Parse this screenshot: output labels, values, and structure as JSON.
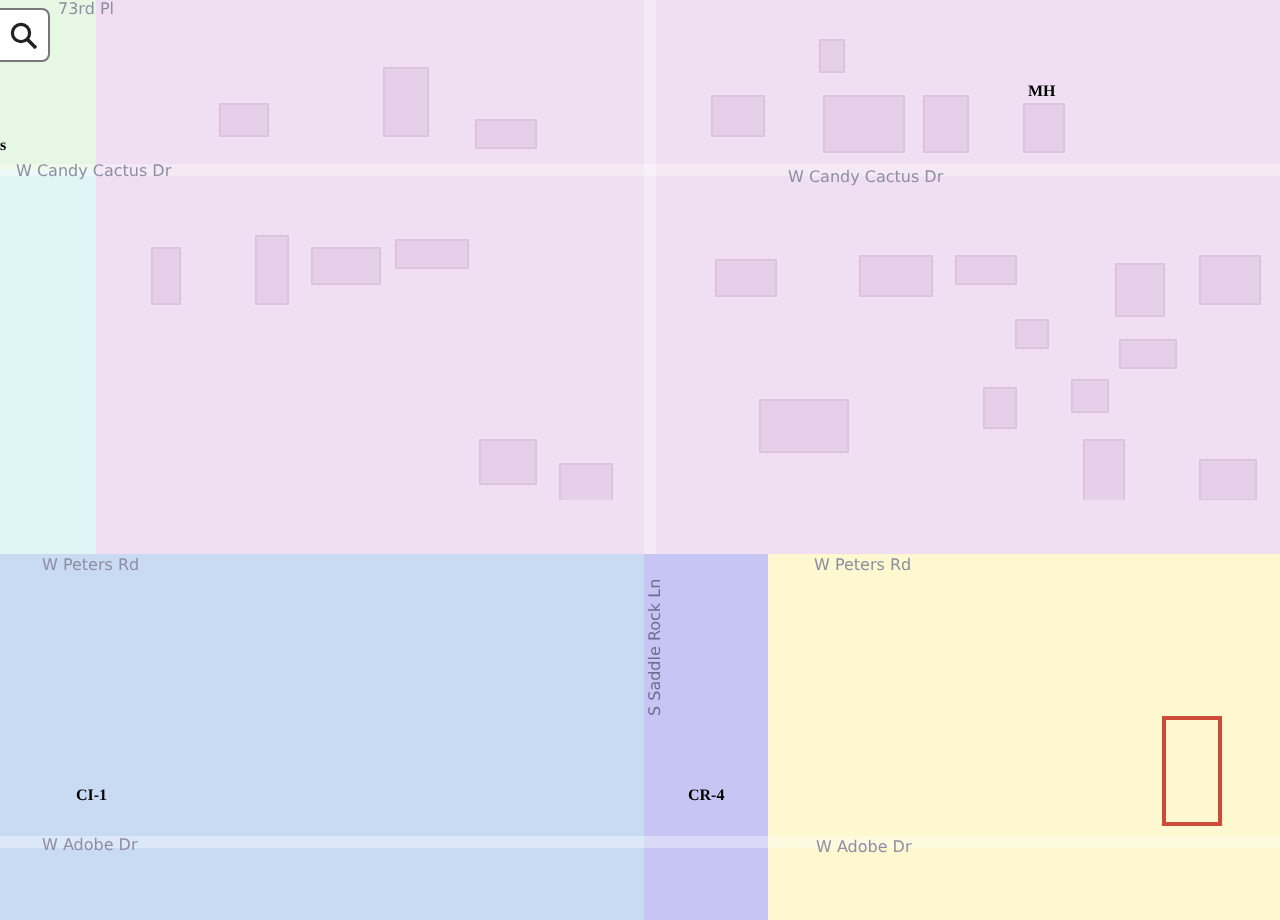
{
  "map": {
    "zones": [
      {
        "color": "#e6f7e4"
      },
      {
        "color": "#e0f6f6"
      },
      {
        "label": "MH",
        "color": "#f0def2"
      },
      {
        "label": "CI-1",
        "color": "#c9daf3"
      },
      {
        "label": "CR-4",
        "color": "#c7c5f3"
      },
      {
        "color": "#fdf8cf"
      }
    ],
    "cut_labels": [
      "s"
    ],
    "streets": [
      {
        "name": "73rd Pl"
      },
      {
        "name": "W Candy Cactus Dr"
      },
      {
        "name": "W Candy Cactus Dr"
      },
      {
        "name": "W Peters Rd"
      },
      {
        "name": "W Peters Rd"
      },
      {
        "name": "S Saddle Rock Ln"
      },
      {
        "name": "W Adobe Dr"
      },
      {
        "name": "W Adobe Dr"
      }
    ],
    "selected_parcel": true
  }
}
